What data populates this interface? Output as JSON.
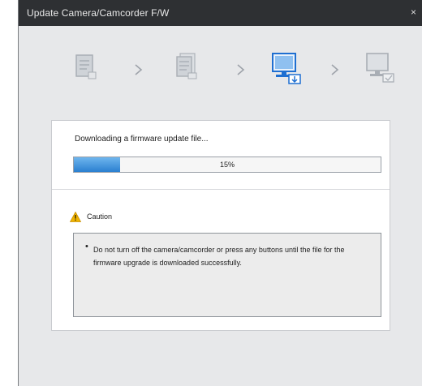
{
  "window": {
    "title": "Update Camera/Camcorder F/W",
    "close_glyph": "×"
  },
  "steps": [
    {
      "name": "document-icon",
      "state": "inactive"
    },
    {
      "name": "document-stack-icon",
      "state": "inactive"
    },
    {
      "name": "computer-download-icon",
      "state": "active"
    },
    {
      "name": "computer-check-icon",
      "state": "inactive"
    }
  ],
  "step_arrow": ">",
  "download": {
    "message": "Downloading a firmware update file...",
    "progress_percent": 15,
    "progress_label": "15%"
  },
  "caution": {
    "label": "Caution",
    "bullet": "•",
    "message": "Do not turn off the camera/camcorder or press any buttons until the file for the firmware upgrade is downloaded successfully."
  },
  "colors": {
    "titlebar": "#2e3033",
    "window_bg": "#e7e8ea",
    "progress_fill": "#2a7fd0",
    "active_step": "#1f6fd1",
    "caution": "#f0b400"
  }
}
